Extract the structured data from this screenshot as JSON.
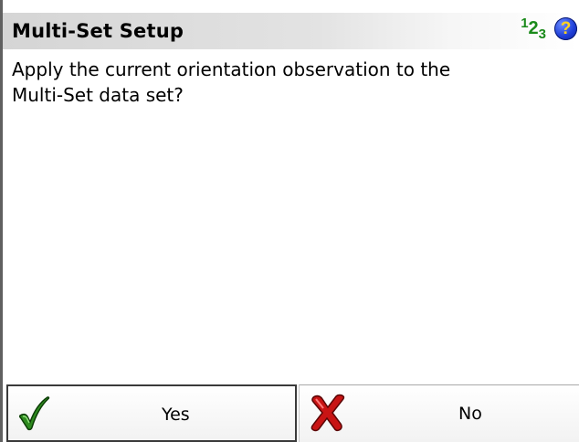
{
  "window": {
    "title": "Multi-Set Setup",
    "input_mode_indicator": {
      "a": "1",
      "b": "2",
      "c": "3"
    },
    "help_icon_glyph": "?"
  },
  "message": {
    "line1": "Apply the current orientation observation to the",
    "line2": "Multi-Set data set?"
  },
  "buttons": {
    "yes": {
      "label": "Yes",
      "icon": "checkmark-icon",
      "color": "#2e8b1f"
    },
    "no": {
      "label": "No",
      "icon": "cross-icon",
      "color": "#c81414"
    }
  },
  "colors": {
    "input_mode_green": "#1a8a1a",
    "help_blue": "#1f3fd8",
    "help_question_yellow": "#ffd21e"
  }
}
